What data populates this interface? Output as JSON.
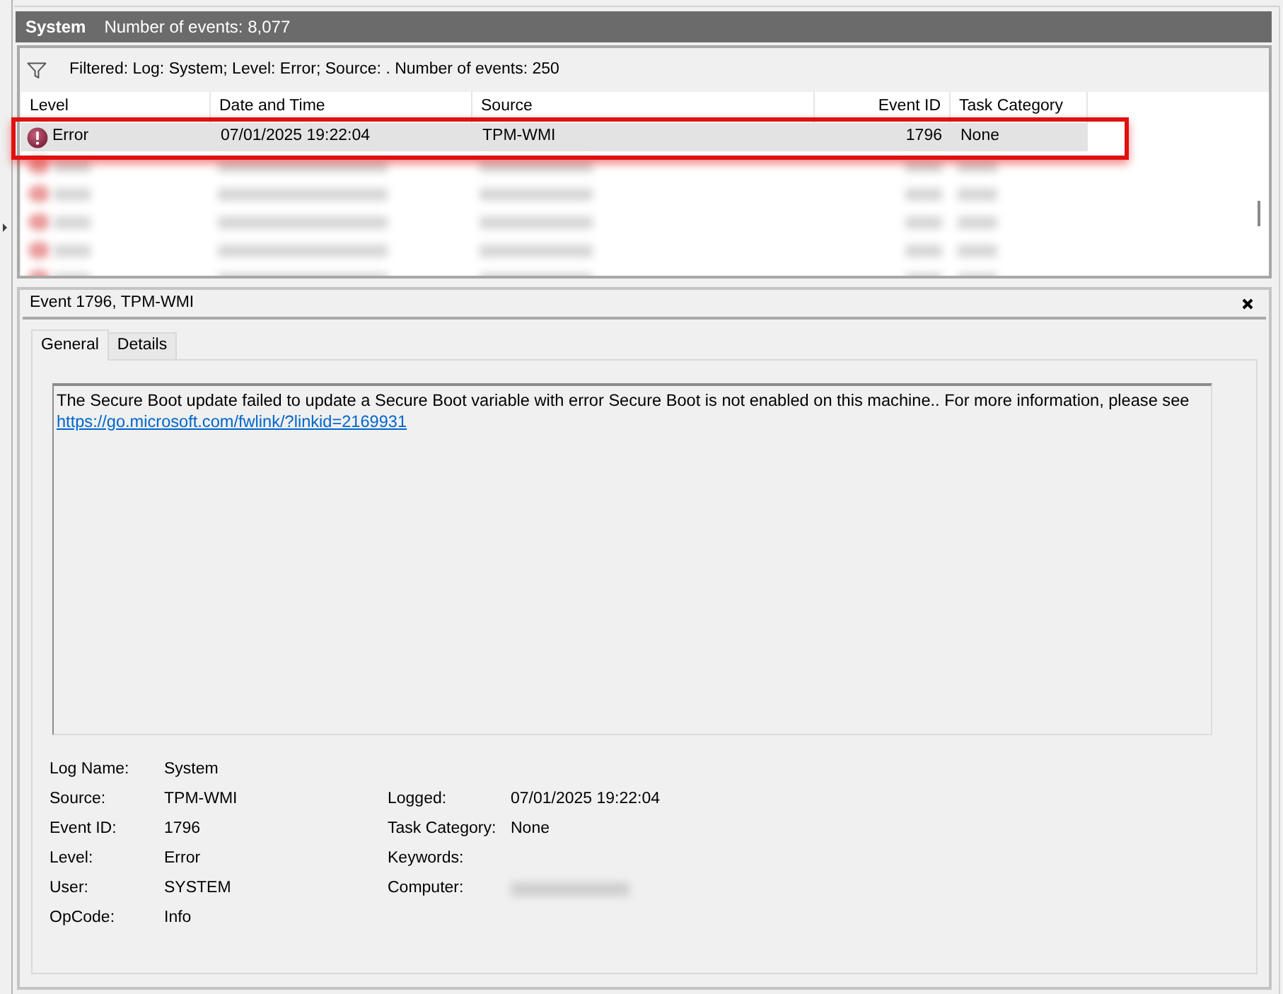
{
  "log_header": {
    "title": "System",
    "event_count": "Number of events: 8,077"
  },
  "filter": {
    "text": "Filtered: Log: System; Level: Error; Source: . Number of events: 250"
  },
  "table": {
    "columns": [
      "Level",
      "Date and Time",
      "Source",
      "Event ID",
      "Task Category"
    ],
    "rows": [
      {
        "level": "Error",
        "date_time": "07/01/2025 19:22:04",
        "source": "TPM-WMI",
        "event_id": "1796",
        "task_category": "None",
        "selected": true,
        "redacted": false,
        "highlighted": true
      },
      {
        "selected": false,
        "redacted": true,
        "highlighted": false
      },
      {
        "selected": false,
        "redacted": true,
        "highlighted": false
      },
      {
        "selected": false,
        "redacted": true,
        "highlighted": false
      },
      {
        "selected": false,
        "redacted": true,
        "highlighted": false
      },
      {
        "selected": false,
        "redacted": true,
        "highlighted": false
      }
    ]
  },
  "details": {
    "title": "Event 1796, TPM-WMI",
    "tabs": [
      {
        "label": "General",
        "selected": true
      },
      {
        "label": "Details",
        "selected": false
      }
    ],
    "description": "The Secure Boot update failed to update a Secure Boot variable with error Secure Boot is not enabled on this machine.. For more information, please see",
    "link": "https://go.microsoft.com/fwlink/?linkid=2169931",
    "properties": [
      {
        "left": {
          "label": "Log Name:",
          "value": "System"
        }
      },
      {
        "left": {
          "label": "Source:",
          "value": "TPM-WMI"
        },
        "right": {
          "label": "Logged:",
          "value": "07/01/2025 19:22:04",
          "redacted": false
        }
      },
      {
        "left": {
          "label": "Event ID:",
          "value": "1796"
        },
        "right": {
          "label": "Task Category:",
          "value": "None",
          "redacted": false
        }
      },
      {
        "left": {
          "label": "Level:",
          "value": "Error"
        },
        "right": {
          "label": "Keywords:",
          "redacted": false
        }
      },
      {
        "left": {
          "label": "User:",
          "value": "SYSTEM"
        },
        "right": {
          "label": "Computer:",
          "redacted": true
        }
      },
      {
        "left": {
          "label": "OpCode:",
          "value": "Info"
        }
      }
    ]
  }
}
